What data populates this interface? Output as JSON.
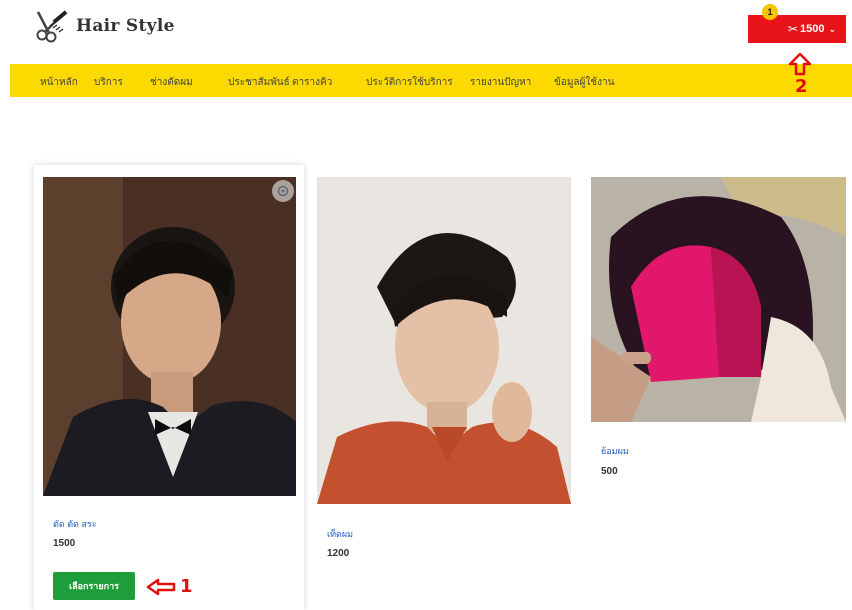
{
  "header": {
    "logo_text": "Hair Style",
    "cart": {
      "badge": "1",
      "amount": "1500",
      "chevron": "⌄"
    }
  },
  "nav": {
    "items": [
      "หน้าหลัก",
      "บริการ",
      "ช่างตัดผม",
      "ประชาสัมพันธ์",
      "ตารางคิว",
      "ประวัติการใช้บริการ",
      "รายงานปัญหา",
      "ข้อมูลผู้ใช้งาน"
    ]
  },
  "products": [
    {
      "name": "ตัด ตัด สระ",
      "price": "1500",
      "button": "เลือกรายการ"
    },
    {
      "name": "เท็ดผม",
      "price": "1200"
    },
    {
      "name": "ย้อมผม",
      "price": "500"
    }
  ],
  "annotations": {
    "arrow_1_label": "1",
    "arrow_2_label": "2"
  },
  "colors": {
    "nav_bg": "#fcd900",
    "cart_bg": "#e8141a",
    "badge_bg": "#f7c600",
    "button_green": "#1e9e3a",
    "link_blue": "#1f5fbf",
    "annotation_red": "#e01010"
  }
}
